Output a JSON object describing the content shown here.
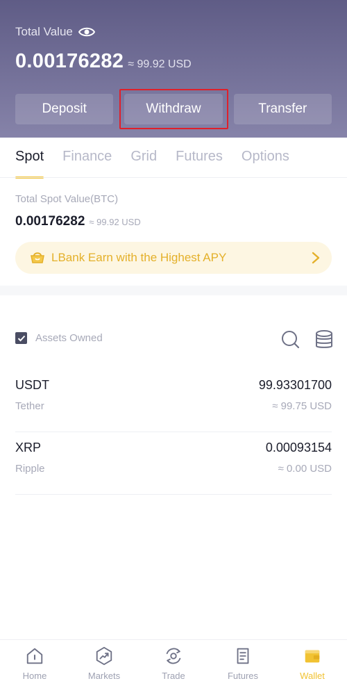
{
  "header": {
    "total_value_label": "Total Value",
    "total_value": "0.00176282",
    "total_value_usd": "≈ 99.92 USD",
    "buttons": {
      "deposit": "Deposit",
      "withdraw": "Withdraw",
      "transfer": "Transfer"
    }
  },
  "tabs": [
    {
      "label": "Spot",
      "active": true
    },
    {
      "label": "Finance"
    },
    {
      "label": "Grid"
    },
    {
      "label": "Futures"
    },
    {
      "label": "Options"
    }
  ],
  "spot": {
    "label": "Total Spot Value(BTC)",
    "value": "0.00176282",
    "usd": "≈ 99.92 USD"
  },
  "banner": {
    "text": "LBank Earn with the Highest APY"
  },
  "assets": {
    "filter_label": "Assets Owned",
    "rows": [
      {
        "symbol": "USDT",
        "name": "Tether",
        "amount": "99.93301700",
        "usd": "≈ 99.75 USD"
      },
      {
        "symbol": "XRP",
        "name": "Ripple",
        "amount": "0.00093154",
        "usd": "≈ 0.00 USD"
      }
    ]
  },
  "nav": {
    "items": [
      {
        "label": "Home",
        "icon": "home-icon"
      },
      {
        "label": "Markets",
        "icon": "markets-icon"
      },
      {
        "label": "Trade",
        "icon": "trade-icon"
      },
      {
        "label": "Futures",
        "icon": "futures-icon"
      },
      {
        "label": "Wallet",
        "icon": "wallet-icon",
        "active": true
      }
    ]
  },
  "colors": {
    "accent": "#f1c232",
    "highlight_border": "#e0202a",
    "header_top": "#5f5c86",
    "header_bottom": "#8683a9"
  }
}
